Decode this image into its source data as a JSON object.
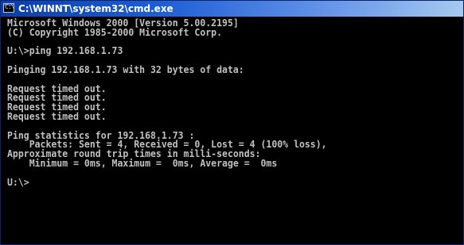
{
  "window": {
    "title": "C:\\WINNT\\system32\\cmd.exe"
  },
  "console": {
    "lines": [
      "Microsoft Windows 2000 [Version 5.00.2195]",
      "(C) Copyright 1985-2000 Microsoft Corp.",
      "",
      "U:\\>ping 192.168.1.73",
      "",
      "Pinging 192.168.1.73 with 32 bytes of data:",
      "",
      "Request timed out.",
      "Request timed out.",
      "Request timed out.",
      "Request timed out.",
      "",
      "Ping statistics for 192.168.1.73 :",
      "    Packets: Sent = 4, Received = 0, Lost = 4 (100% loss),",
      "Approximate round trip times in milli-seconds:",
      "    Minimum = 0ms, Maximum =  0ms, Average =  0ms",
      "",
      "U:\\>"
    ]
  },
  "colors": {
    "console_background": "#000000",
    "console_text": "#c0c0c0",
    "titlebar_start": "#0a3ea8",
    "titlebar_end": "#a6caf0",
    "title_text": "#ffffff"
  }
}
